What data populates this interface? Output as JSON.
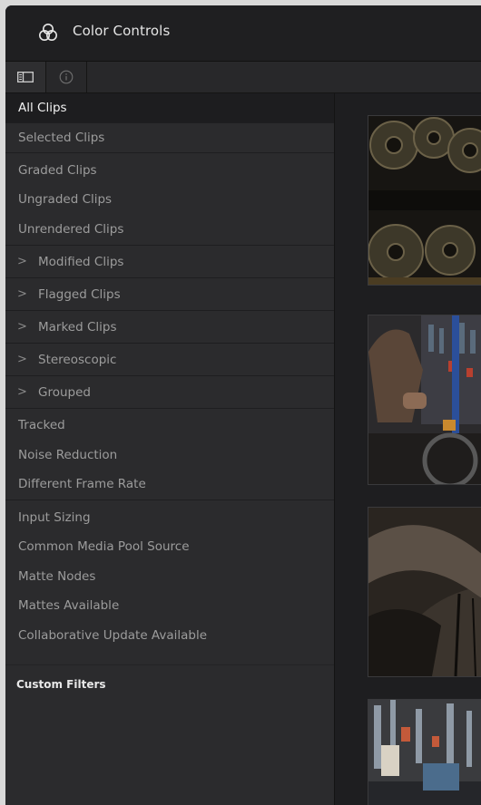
{
  "window": {
    "title": "Color Controls",
    "title_icon": "color-wheels-icon"
  },
  "toolbar": {
    "buttons": [
      {
        "icon": "sidebar-toggle-icon",
        "active": true
      },
      {
        "icon": "info-icon",
        "active": false
      }
    ]
  },
  "sidebar": {
    "items": [
      {
        "label": "All Clips",
        "selected": true
      },
      {
        "label": "Selected Clips"
      },
      {
        "label": "Graded Clips"
      },
      {
        "label": "Ungraded Clips"
      },
      {
        "label": "Unrendered Clips"
      },
      {
        "label": "Modified Clips",
        "expandable": true
      },
      {
        "label": "Flagged Clips",
        "expandable": true
      },
      {
        "label": "Marked Clips",
        "expandable": true
      },
      {
        "label": "Stereoscopic",
        "expandable": true
      },
      {
        "label": "Grouped",
        "expandable": true
      },
      {
        "label": "Tracked"
      },
      {
        "label": "Noise Reduction"
      },
      {
        "label": "Different Frame Rate"
      },
      {
        "label": "Input Sizing"
      },
      {
        "label": "Common Media Pool Source"
      },
      {
        "label": "Matte Nodes"
      },
      {
        "label": "Mattes Available"
      },
      {
        "label": "Collaborative Update Available"
      }
    ],
    "chevron": ">",
    "custom_filters_heading": "Custom Filters"
  },
  "clips": [
    {
      "subject": "bicycle cassette gears"
    },
    {
      "subject": "mechanic working on bicycle"
    },
    {
      "subject": "bicycle tire close-up"
    },
    {
      "subject": "bicycle shop tools"
    }
  ],
  "colors": {
    "background": "#1c1c1e",
    "sidebar": "#2b2b2d",
    "selected_row": "#1d1d1f",
    "text": "#9c9c9c",
    "text_selected": "#f2f2f2"
  }
}
